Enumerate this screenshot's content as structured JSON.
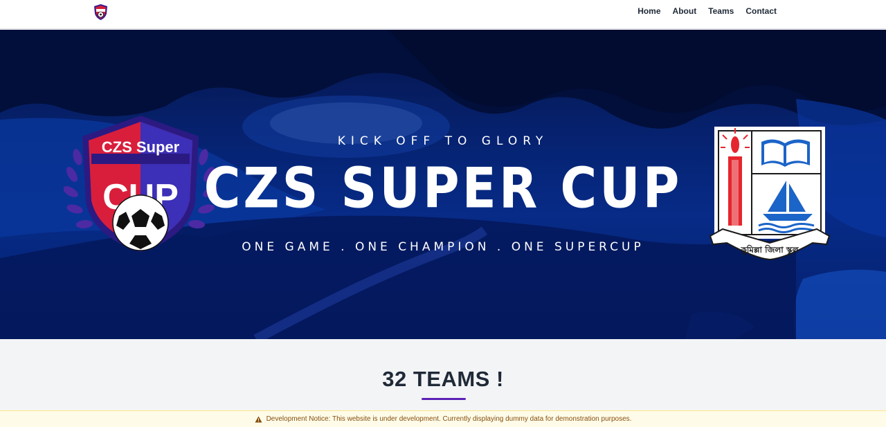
{
  "nav": {
    "logo": "czs-super-cup-logo",
    "links": [
      "Home",
      "About",
      "Teams",
      "Contact"
    ]
  },
  "hero": {
    "tagline": "KICK OFF TO GLORY",
    "title": "CZS SUPER CUP",
    "subtitle": "ONE GAME . ONE CHAMPION . ONE SUPERCUP",
    "left_badge_text_top": "CZS Super",
    "left_badge_text_main": "CUP",
    "right_badge_caption": "কুমিল্লা জিলা স্কুল"
  },
  "section": {
    "title": "32 TEAMS !"
  },
  "notice": {
    "icon": "warning-icon",
    "text": "Development Notice: This website is under development. Currently displaying dummy data for demonstration purposes."
  },
  "colors": {
    "accent": "#5b21b6",
    "hero_blue": "#0b3bb0",
    "notice_bg": "#fefce8",
    "notice_text": "#854d0e"
  }
}
